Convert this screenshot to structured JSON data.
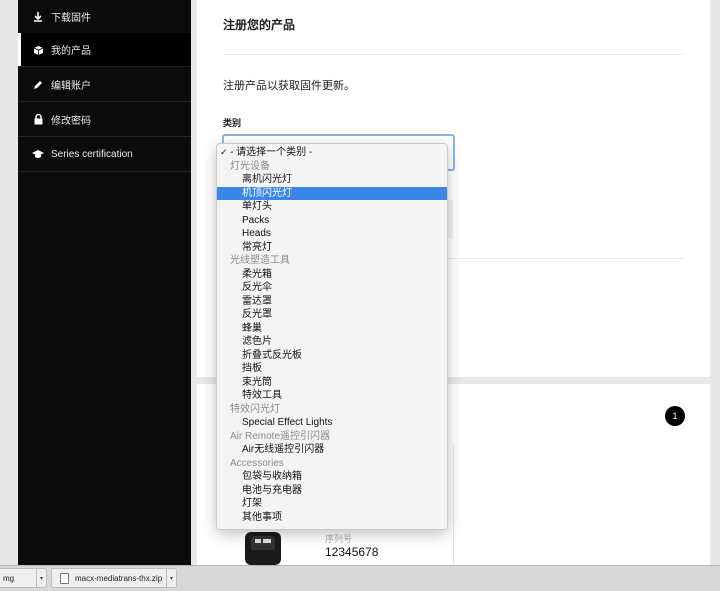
{
  "sidebar": {
    "items": [
      {
        "label": "下载固件",
        "icon": "download-icon"
      },
      {
        "label": "我的产品",
        "icon": "box-icon"
      },
      {
        "label": "编辑账户",
        "icon": "pencil-icon"
      },
      {
        "label": "修改密码",
        "icon": "lock-icon"
      },
      {
        "label": "Series certification",
        "icon": "graduation-cap-icon"
      }
    ],
    "active_index": 1
  },
  "card": {
    "title": "注册您的产品",
    "intro": "注册产品以获取固件更新。",
    "category_label": "类别"
  },
  "dropdown": {
    "selected": "- 请选择一个类别 -",
    "check": "✓",
    "rows": [
      {
        "type": "first",
        "label": "- 请选择一个类别 -"
      },
      {
        "type": "group",
        "label": "灯光设备"
      },
      {
        "type": "opt",
        "label": "离机闪光灯"
      },
      {
        "type": "opt",
        "label": "机顶闪光灯",
        "highlighted": true
      },
      {
        "type": "opt",
        "label": "单灯头"
      },
      {
        "type": "opt",
        "label": "Packs"
      },
      {
        "type": "opt",
        "label": "Heads"
      },
      {
        "type": "opt",
        "label": "常亮灯"
      },
      {
        "type": "group",
        "label": "光线塑造工具"
      },
      {
        "type": "opt",
        "label": "柔光箱"
      },
      {
        "type": "opt",
        "label": "反光伞"
      },
      {
        "type": "opt",
        "label": "雷达罩"
      },
      {
        "type": "opt",
        "label": "反光罩"
      },
      {
        "type": "opt",
        "label": "蜂巢"
      },
      {
        "type": "opt",
        "label": "滤色片"
      },
      {
        "type": "opt",
        "label": "折叠式反光板"
      },
      {
        "type": "opt",
        "label": "挡板"
      },
      {
        "type": "opt",
        "label": "束光筒"
      },
      {
        "type": "opt",
        "label": "特效工具"
      },
      {
        "type": "group",
        "label": "特效闪光灯"
      },
      {
        "type": "opt",
        "label": "Special Effect Lights"
      },
      {
        "type": "group",
        "label": "Air Remote遥控引闪器"
      },
      {
        "type": "opt",
        "label": "Air无线遥控引闪器"
      },
      {
        "type": "group",
        "label": "Accessories"
      },
      {
        "type": "opt",
        "label": "包袋与收纳箱"
      },
      {
        "type": "opt",
        "label": "电池与充电器"
      },
      {
        "type": "opt",
        "label": "灯架"
      },
      {
        "type": "opt",
        "label": "其他事项"
      }
    ]
  },
  "product": {
    "badge": "1",
    "serial_label": "序列号",
    "serial_value": "12345678"
  },
  "downloads": [
    {
      "name": "mg"
    },
    {
      "name": "macx-mediatrans-thx.zip"
    }
  ],
  "colors": {
    "sidebar_bg": "#0b0b0b",
    "highlight": "#3b87e8",
    "focus_border": "#8ab4e8"
  }
}
